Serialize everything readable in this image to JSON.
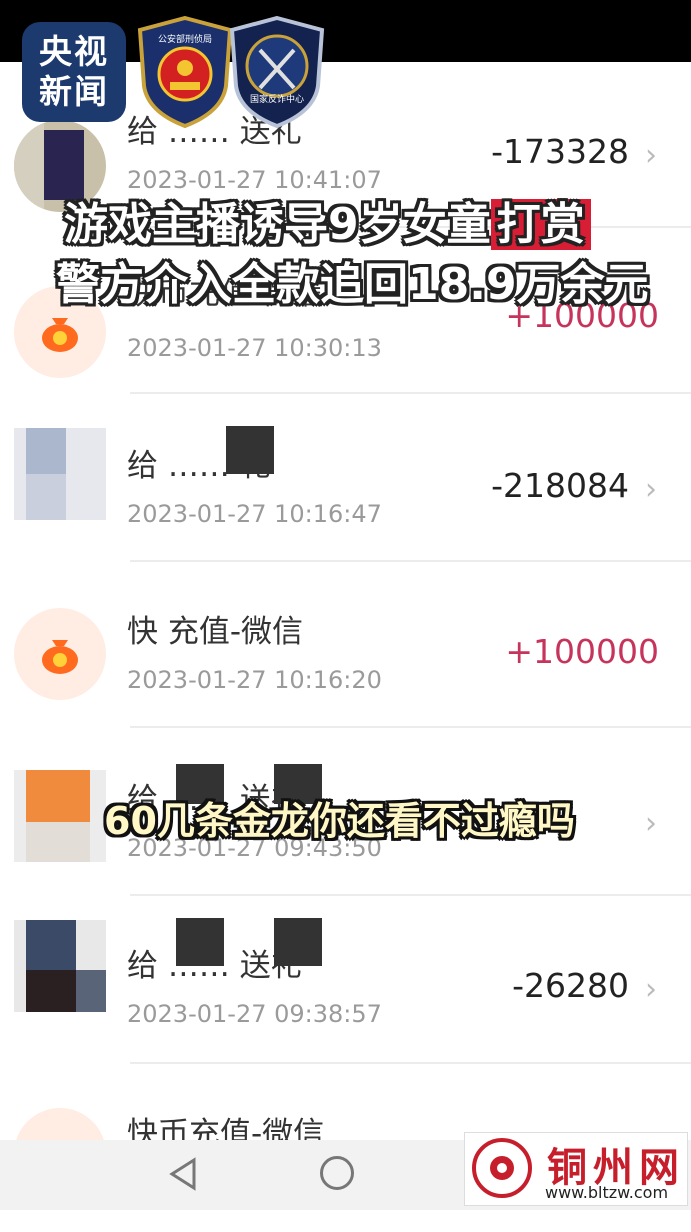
{
  "overlay": {
    "channel_logo": "央视\n新闻",
    "badge_left": "公安部刑侦局",
    "badge_right": "国家反诈中心",
    "headline_line1_main": "游戏主播诱导9岁女童",
    "headline_line1_highlight": "打赏",
    "headline_line2": "警方介入全款追回18.9万余元",
    "caption": "60几条金龙你还看不过瘾吗"
  },
  "transactions": [
    {
      "title": "给 …… 送礼",
      "time": "2023-01-27 10:41:07",
      "amount": "-173328"
    },
    {
      "title": "快币充值-微信",
      "time": "2023-01-27 10:30:13",
      "amount": "+100000"
    },
    {
      "title": "给 …… 礼",
      "time": "2023-01-27 10:16:47",
      "amount": "-218084"
    },
    {
      "title": "快 充值-微信",
      "time": "2023-01-27 10:16:20",
      "amount": "+100000"
    },
    {
      "title": "给 …… 送礼",
      "time": "2023-01-27 09:43:50",
      "amount": ""
    },
    {
      "title": "给 …… 送礼",
      "time": "2023-01-27 09:38:57",
      "amount": "-26280"
    },
    {
      "title": "快币充值-微信",
      "time": "",
      "amount": ""
    }
  ],
  "watermark": {
    "name": "铜州网",
    "url": "www.bltzw.com"
  },
  "colors": {
    "positive_amount": "#c7345b",
    "highlight_red": "#d81e34",
    "coin_orange": "#ff6a1f"
  },
  "icons": {
    "recharge_avatar": "coin-bag-icon",
    "row_arrow": "chevron-right-icon",
    "nav_back": "triangle-back-icon",
    "nav_home": "circle-home-icon"
  }
}
